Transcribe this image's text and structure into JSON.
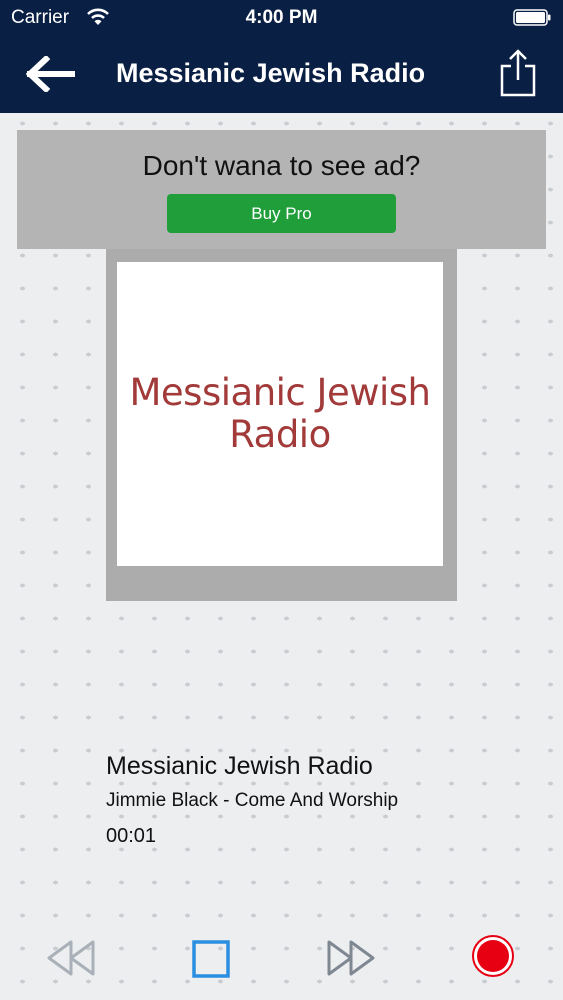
{
  "status_bar": {
    "carrier": "Carrier",
    "time": "4:00 PM",
    "wifi_icon": "wifi-icon",
    "battery_icon": "battery-icon"
  },
  "nav": {
    "title": "Messianic Jewish Radio",
    "back_icon": "back-arrow-icon",
    "share_icon": "share-icon"
  },
  "ad": {
    "message": "Don't wana to see ad?",
    "button_label": "Buy Pro"
  },
  "artwork": {
    "line1": "Messianic Jewish",
    "line2": "Radio"
  },
  "now_playing": {
    "station": "Messianic Jewish Radio",
    "track": "Jimmie Black - Come And Worship",
    "elapsed": "00:01"
  },
  "controls": {
    "rewind_icon": "rewind-icon",
    "stop_icon": "stop-icon",
    "fast_forward_icon": "fast-forward-icon",
    "record_icon": "record-icon"
  },
  "colors": {
    "nav_background": "#0a1f44",
    "buy_pro": "#1f9e3a",
    "stop": "#2a8fe0",
    "record": "#e60012",
    "logo_text": "#a23a3a"
  }
}
